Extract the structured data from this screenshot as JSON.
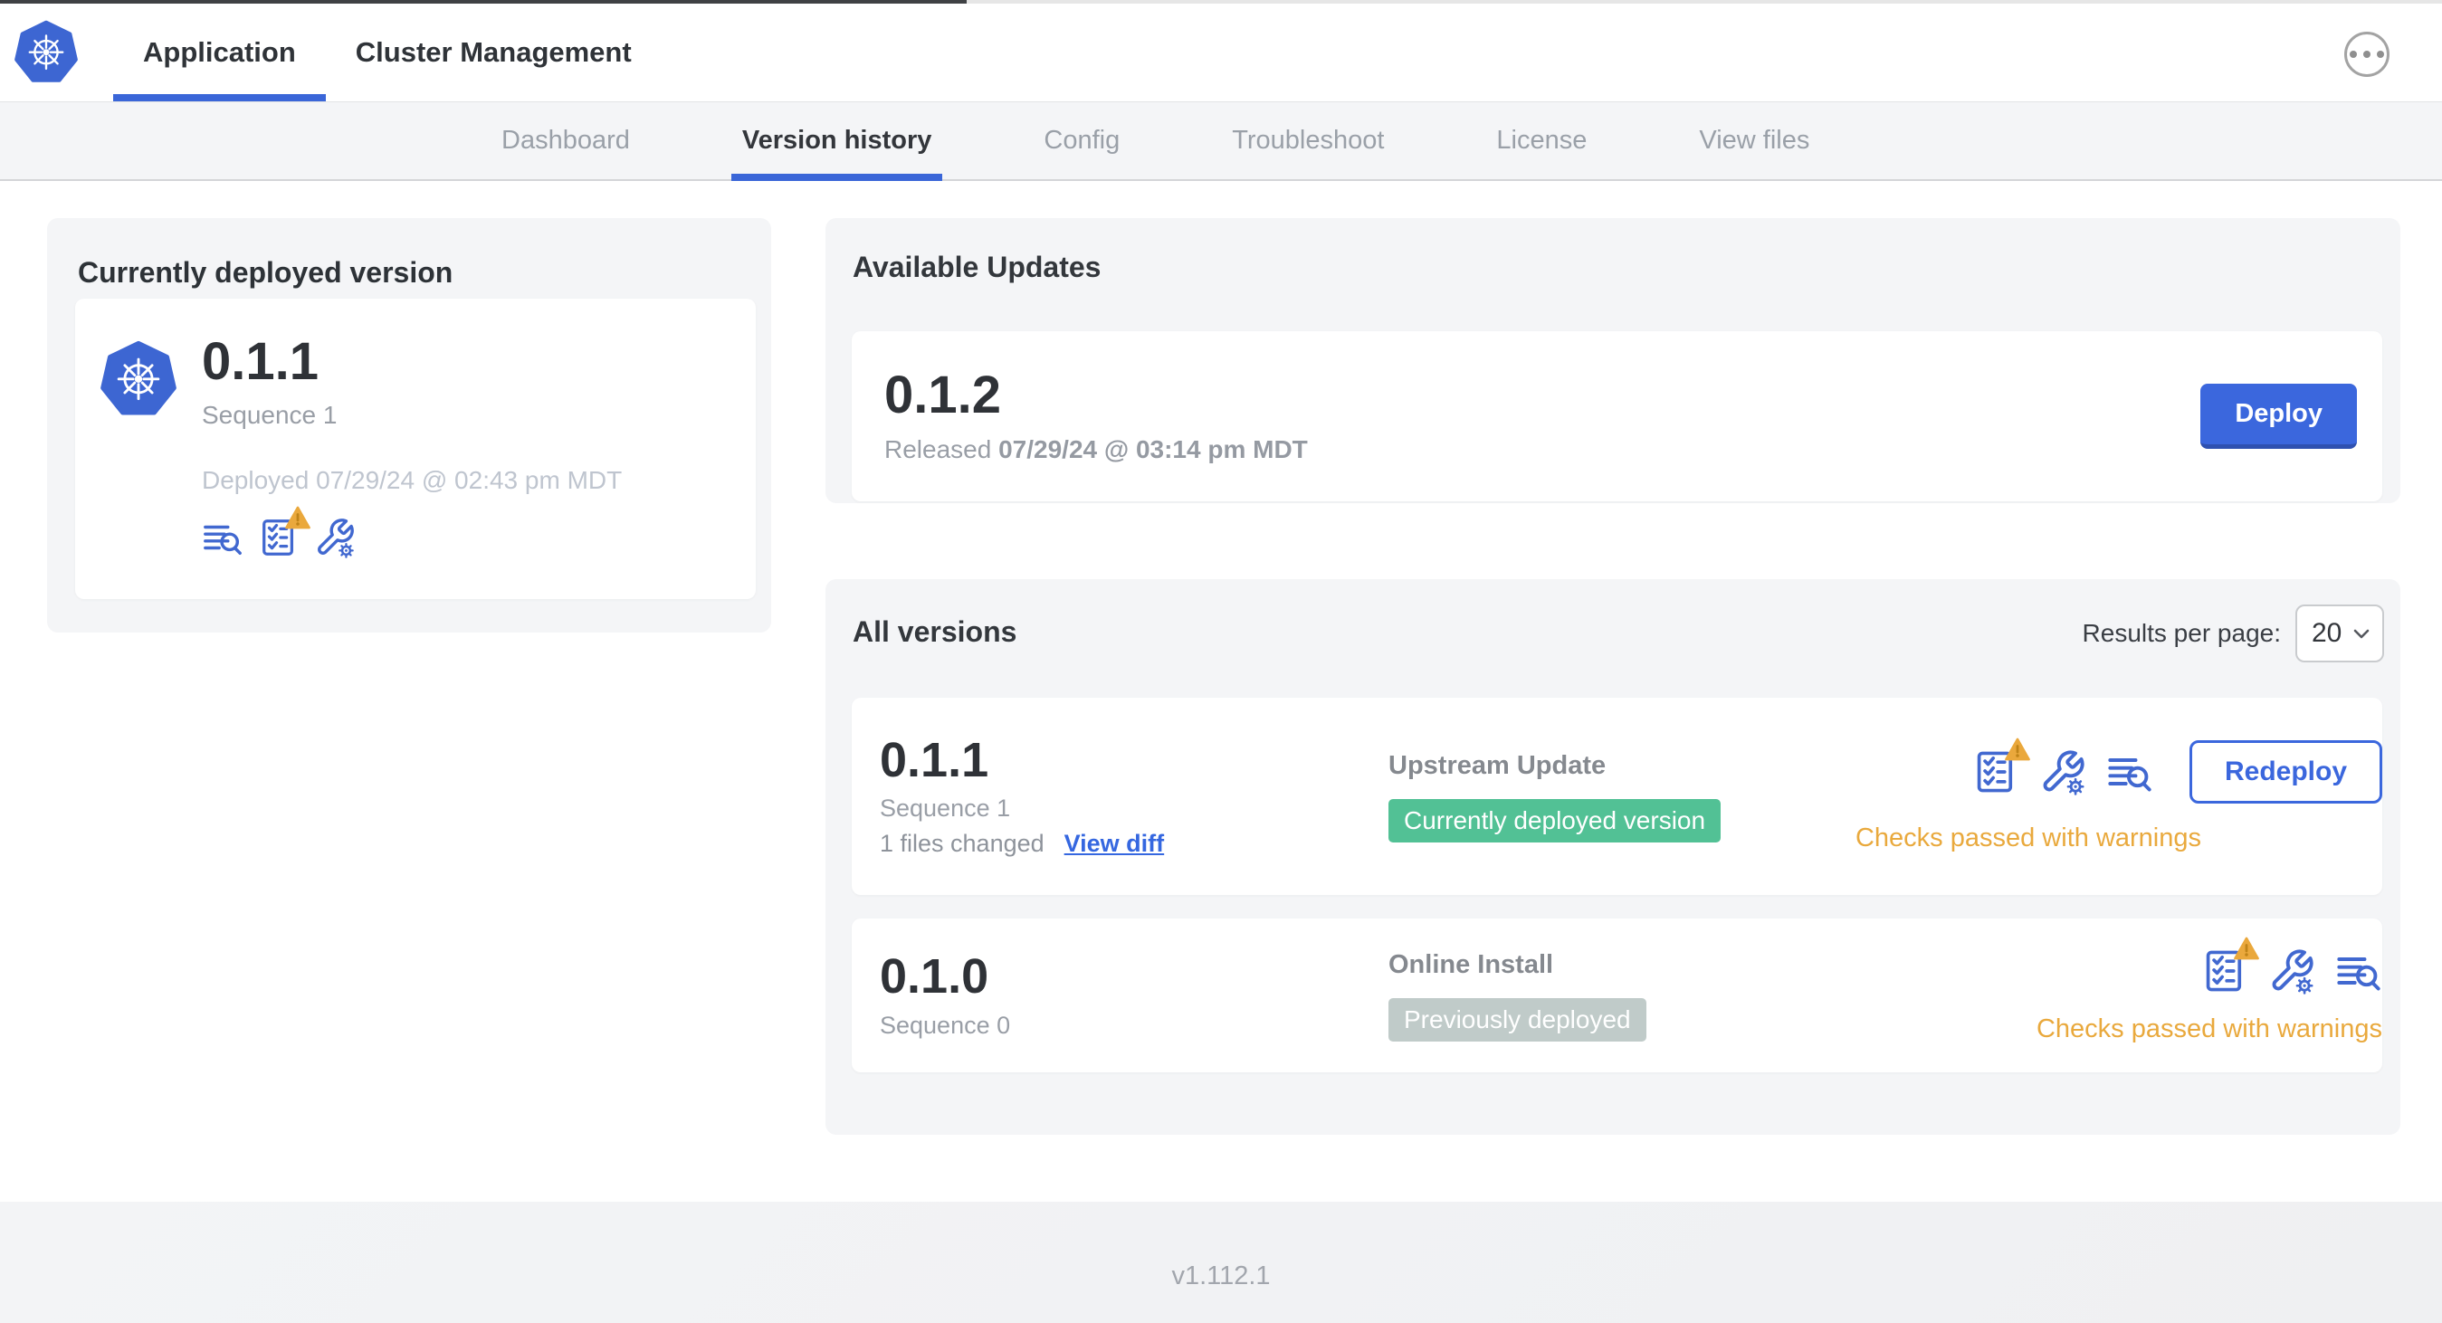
{
  "header": {
    "tabs": [
      {
        "label": "Application"
      },
      {
        "label": "Cluster Management"
      }
    ],
    "menu_icon": "ellipsis-menu"
  },
  "subnav": {
    "tabs": [
      {
        "label": "Dashboard"
      },
      {
        "label": "Version history",
        "active": true
      },
      {
        "label": "Config"
      },
      {
        "label": "Troubleshoot"
      },
      {
        "label": "License"
      },
      {
        "label": "View files"
      }
    ]
  },
  "currently_deployed": {
    "title": "Currently deployed version",
    "version": "0.1.1",
    "sequence": "Sequence 1",
    "deployed_text": "Deployed 07/29/24 @ 02:43 pm MDT",
    "icons": [
      "log-search-icon",
      "checklist-warning-icon",
      "wrench-gear-icon"
    ]
  },
  "available_updates": {
    "title": "Available Updates",
    "version": "0.1.2",
    "released_label": "Released",
    "released_date": "07/29/24 @ 03:14 pm MDT",
    "deploy_label": "Deploy"
  },
  "all_versions": {
    "title": "All versions",
    "results_label": "Results per page:",
    "results_value": "20",
    "rows": [
      {
        "version": "0.1.1",
        "sequence": "Sequence 1",
        "files_changed": "1 files changed",
        "view_diff": "View diff",
        "source": "Upstream Update",
        "badge": {
          "label": "Currently deployed version",
          "color": "#52c195"
        },
        "icons": [
          "checklist-warning-icon",
          "wrench-gear-icon",
          "log-search-icon"
        ],
        "action_label": "Redeploy",
        "status": "Checks passed with warnings"
      },
      {
        "version": "0.1.0",
        "sequence": "Sequence 0",
        "source": "Online Install",
        "badge": {
          "label": "Previously deployed",
          "color": "#c0cbc9"
        },
        "icons": [
          "checklist-warning-icon",
          "wrench-gear-icon",
          "log-search-icon"
        ],
        "status": "Checks passed with warnings"
      }
    ]
  },
  "footer": {
    "version": "v1.112.1"
  },
  "colors": {
    "accent_blue": "#3b67dd",
    "icon_blue": "#4168d0",
    "badge_green": "#52c195",
    "badge_gray": "#c0cbc9",
    "warning_orange": "#e9a93d",
    "logo_blue": "#3d66d2",
    "subnav_bg": "#f4f5f7"
  }
}
